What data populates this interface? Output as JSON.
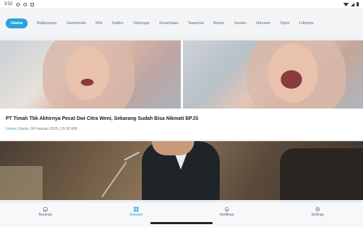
{
  "statusbar": {
    "time": "3:52",
    "icons": [
      "alarm-icon",
      "location-icon",
      "shield-icon"
    ],
    "right_icons": [
      "wifi-icon",
      "signal-icon",
      "battery-icon"
    ]
  },
  "tabs": [
    {
      "label": "Utama",
      "active": true
    },
    {
      "label": "Balikpapan",
      "active": false
    },
    {
      "label": "Samarinda",
      "active": false
    },
    {
      "label": "IKN",
      "active": false
    },
    {
      "label": "Kaltim",
      "active": false
    },
    {
      "label": "Olahraga",
      "active": false
    },
    {
      "label": "Kesehatan",
      "active": false
    },
    {
      "label": "Nasional",
      "active": false
    },
    {
      "label": "Bisnis",
      "active": false
    },
    {
      "label": "Sosbio",
      "active": false
    },
    {
      "label": "Hiburan",
      "active": false
    },
    {
      "label": "Opini",
      "active": false
    },
    {
      "label": "Lifestyle",
      "active": false
    }
  ],
  "article": {
    "headline": "PT Timah Tbk Akhirnya Pecat Dwi Citra Weni, Sekarang Sudah Bisa Nikmati BPJS",
    "category": "Utama",
    "separator": " | ",
    "date": "Kamis, 06 Februari 2025 | 15:18 WIB"
  },
  "bottomnav": [
    {
      "label": "Beranda",
      "icon": "home-icon",
      "active": false
    },
    {
      "label": "Kategori",
      "icon": "grid-icon",
      "active": true
    },
    {
      "label": "Notifikasi",
      "icon": "bell-icon",
      "active": false
    },
    {
      "label": "Settings",
      "icon": "gear-icon",
      "active": false
    }
  ],
  "colors": {
    "accent": "#29a3dc",
    "tab_text": "#5b6b7b",
    "headline": "#1a1a1a"
  }
}
